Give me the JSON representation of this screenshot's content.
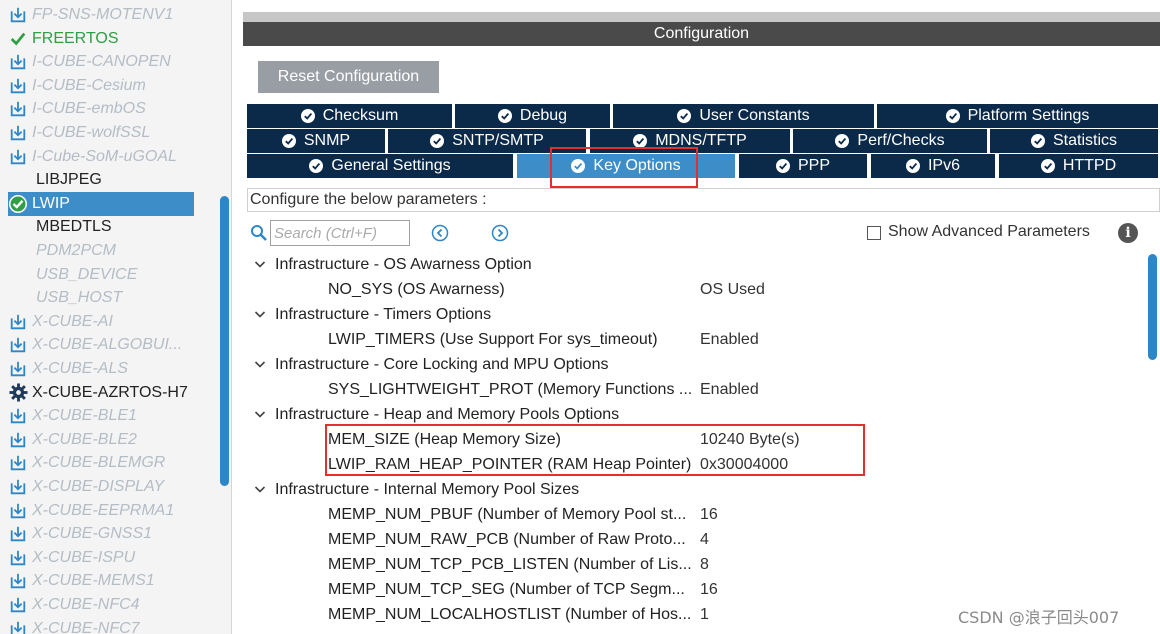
{
  "sidebar": {
    "items": [
      {
        "label": "FP-SNS-MOTENV1",
        "icon": "download-icon",
        "style": "dl"
      },
      {
        "label": "FREERTOS",
        "icon": "check-icon",
        "style": "green"
      },
      {
        "label": "I-CUBE-CANOPEN",
        "icon": "download-icon",
        "style": "dl"
      },
      {
        "label": "I-CUBE-Cesium",
        "icon": "download-icon",
        "style": "dl"
      },
      {
        "label": "I-CUBE-embOS",
        "icon": "download-icon",
        "style": "dl"
      },
      {
        "label": "I-CUBE-wolfSSL",
        "icon": "download-icon",
        "style": "dl"
      },
      {
        "label": "I-Cube-SoM-uGOAL",
        "icon": "download-icon",
        "style": "dl"
      },
      {
        "label": "LIBJPEG",
        "icon": "",
        "style": "plain"
      },
      {
        "label": "LWIP",
        "icon": "check-circle-icon",
        "style": "sel"
      },
      {
        "label": "MBEDTLS",
        "icon": "",
        "style": "plain"
      },
      {
        "label": "PDM2PCM",
        "icon": "",
        "style": "gray"
      },
      {
        "label": "USB_DEVICE",
        "icon": "",
        "style": "gray"
      },
      {
        "label": "USB_HOST",
        "icon": "",
        "style": "gray"
      },
      {
        "label": "X-CUBE-AI",
        "icon": "download-icon",
        "style": "dl"
      },
      {
        "label": "X-CUBE-ALGOBUI...",
        "icon": "download-icon",
        "style": "dl"
      },
      {
        "label": "X-CUBE-ALS",
        "icon": "download-icon",
        "style": "dl"
      },
      {
        "label": "X-CUBE-AZRTOS-H7",
        "icon": "gear-icon",
        "style": "plain"
      },
      {
        "label": "X-CUBE-BLE1",
        "icon": "download-icon",
        "style": "dl"
      },
      {
        "label": "X-CUBE-BLE2",
        "icon": "download-icon",
        "style": "dl"
      },
      {
        "label": "X-CUBE-BLEMGR",
        "icon": "download-icon",
        "style": "dl"
      },
      {
        "label": "X-CUBE-DISPLAY",
        "icon": "download-icon",
        "style": "dl"
      },
      {
        "label": "X-CUBE-EEPRMA1",
        "icon": "download-icon",
        "style": "dl"
      },
      {
        "label": "X-CUBE-GNSS1",
        "icon": "download-icon",
        "style": "dl"
      },
      {
        "label": "X-CUBE-ISPU",
        "icon": "download-icon",
        "style": "dl"
      },
      {
        "label": "X-CUBE-MEMS1",
        "icon": "download-icon",
        "style": "dl"
      },
      {
        "label": "X-CUBE-NFC4",
        "icon": "download-icon",
        "style": "dl"
      },
      {
        "label": "X-CUBE-NFC7",
        "icon": "download-icon",
        "style": "dl"
      }
    ]
  },
  "config": {
    "header": "Configuration",
    "reset_label": "Reset Configuration"
  },
  "tabs": {
    "row1": [
      {
        "label": "Checksum"
      },
      {
        "label": "Debug"
      },
      {
        "label": "User Constants"
      },
      {
        "label": "Platform Settings"
      }
    ],
    "row2": [
      {
        "label": "SNMP"
      },
      {
        "label": "SNTP/SMTP"
      },
      {
        "label": "MDNS/TFTP"
      },
      {
        "label": "Perf/Checks"
      },
      {
        "label": "Statistics"
      }
    ],
    "row3": [
      {
        "label": "General Settings"
      },
      {
        "label": "Key Options",
        "active": true
      },
      {
        "label": "PPP"
      },
      {
        "label": "IPv6"
      },
      {
        "label": "HTTPD"
      }
    ]
  },
  "params_bar": "Configure the below parameters :",
  "search": {
    "placeholder": "Search (Ctrl+F)"
  },
  "advanced": {
    "label": "Show Advanced Parameters",
    "checked": false
  },
  "tree": [
    {
      "type": "group",
      "label": "Infrastructure - OS Awarness Option"
    },
    {
      "type": "param",
      "label": "NO_SYS (OS Awarness)",
      "value": "OS Used"
    },
    {
      "type": "group",
      "label": "Infrastructure - Timers Options"
    },
    {
      "type": "param",
      "label": "LWIP_TIMERS (Use Support For sys_timeout)",
      "value": "Enabled"
    },
    {
      "type": "group",
      "label": "Infrastructure - Core Locking and MPU Options"
    },
    {
      "type": "param",
      "label": "SYS_LIGHTWEIGHT_PROT (Memory Functions ...",
      "value": "Enabled"
    },
    {
      "type": "group",
      "label": "Infrastructure - Heap and Memory Pools Options"
    },
    {
      "type": "param",
      "label": "MEM_SIZE (Heap Memory Size)",
      "value": "10240 Byte(s)"
    },
    {
      "type": "param",
      "label": "LWIP_RAM_HEAP_POINTER (RAM Heap Pointer)",
      "value": "0x30004000"
    },
    {
      "type": "group",
      "label": "Infrastructure - Internal Memory Pool Sizes"
    },
    {
      "type": "param",
      "label": "MEMP_NUM_PBUF (Number of Memory Pool st...",
      "value": "16"
    },
    {
      "type": "param",
      "label": "MEMP_NUM_RAW_PCB (Number of Raw Proto...",
      "value": "4"
    },
    {
      "type": "param",
      "label": "MEMP_NUM_TCP_PCB_LISTEN (Number of Lis...",
      "value": "8"
    },
    {
      "type": "param",
      "label": "MEMP_NUM_TCP_SEG (Number of TCP Segm...",
      "value": "16"
    },
    {
      "type": "param",
      "label": "MEMP_NUM_LOCALHOSTLIST (Number of Hos...",
      "value": "1"
    }
  ],
  "watermark": "CSDN @浪子回头007",
  "colors": {
    "tab_bg": "#0b2a4a",
    "tab_active": "#3c8dc8",
    "selection": "#3c8dc8",
    "highlight_box": "#e03030",
    "enabled_green": "#2f9e44"
  }
}
